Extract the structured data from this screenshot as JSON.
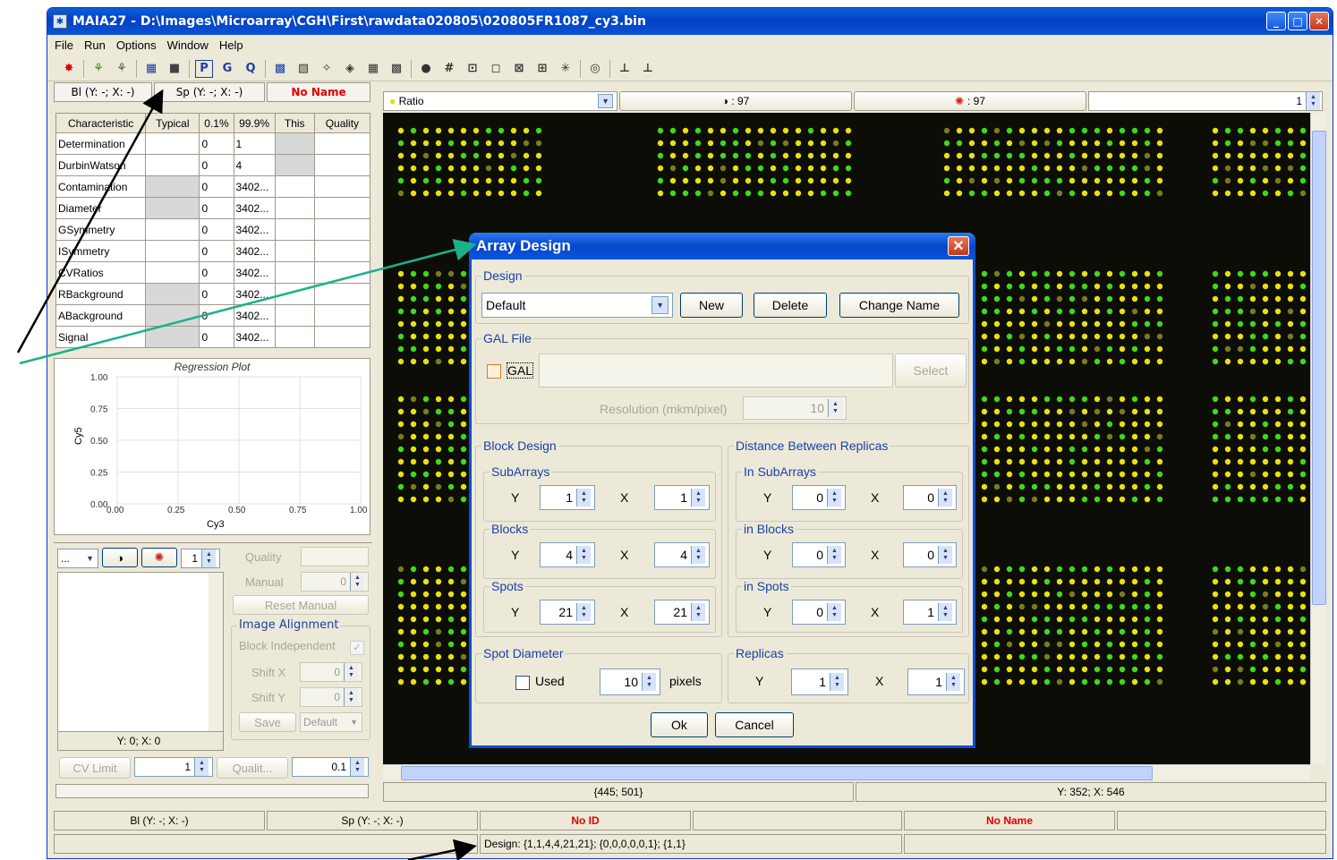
{
  "window": {
    "title": "MAIA27 - D:\\Images\\Microarray\\CGH\\First\\rawdata020805\\020805FR1087_cy3.bin",
    "menu": [
      "File",
      "Run",
      "Options",
      "Window",
      "Help"
    ]
  },
  "left_header": {
    "bl": "Bl (Y: -; X: -)",
    "sp": "Sp (Y: -; X: -)",
    "name": "No Name"
  },
  "char_table": {
    "headers": [
      "Characteristic",
      "Typical",
      "0.1%",
      "99.9%",
      "This",
      "Quality"
    ],
    "rows": [
      [
        "Determination",
        "",
        "0",
        "1",
        "",
        ""
      ],
      [
        "DurbinWatson",
        "",
        "0",
        "4",
        "",
        ""
      ],
      [
        "Contamination",
        "",
        "0",
        "3402...",
        "",
        ""
      ],
      [
        "Diameter",
        "",
        "0",
        "3402...",
        "",
        ""
      ],
      [
        "GSymmetry",
        "",
        "0",
        "3402...",
        "",
        ""
      ],
      [
        "ISymmetry",
        "",
        "0",
        "3402...",
        "",
        ""
      ],
      [
        "CVRatios",
        "",
        "0",
        "3402...",
        "",
        ""
      ],
      [
        "RBackground",
        "",
        "0",
        "3402...",
        "",
        ""
      ],
      [
        "ABackground",
        "",
        "0",
        "3402...",
        "",
        ""
      ],
      [
        "Signal",
        "",
        "0",
        "3402...",
        "",
        ""
      ]
    ]
  },
  "regression_plot": {
    "title": "Regression Plot",
    "xlabel": "Cy3",
    "ylabel": "Cy5",
    "ticks": [
      "0.00",
      "0.25",
      "0.50",
      "0.75",
      "1.00"
    ]
  },
  "controls": {
    "dropdown": "...",
    "spin_value": "1",
    "quality_label": "Quality",
    "manual_label": "Manual",
    "manual_value": "0",
    "reset_manual": "Reset Manual",
    "image_alignment": "Image Alignment",
    "block_independent": "Block Independent",
    "shift_x": "Shift X",
    "shift_x_value": "0",
    "shift_y": "Shift Y",
    "shift_y_value": "0",
    "save": "Save",
    "default": "Default",
    "coords": "Y: 0; X: 0",
    "cv_limit": "CV Limit",
    "cv_value": "1",
    "qualit": "Qualit...",
    "qualit_value": "0.1"
  },
  "image_bar": {
    "mode": "Ratio",
    "val1": "◑ : 97",
    "val2": ": 97",
    "spin": "1"
  },
  "image_status": {
    "left": "{445; 501}",
    "right": "Y: 352; X: 546"
  },
  "bottom_status": {
    "bl": "Bl (Y: -; X: -)",
    "sp": "Sp (Y: -; X: -)",
    "id": "No ID",
    "name": "No Name",
    "design": "Design: {1,1,4,4,21,21}; {0,0,0,0,0,1}; {1,1}"
  },
  "dialog": {
    "title": "Array Design",
    "design_group": "Design",
    "design_value": "Default",
    "new": "New",
    "delete": "Delete",
    "change_name": "Change Name",
    "gal_group": "GAL File",
    "gal_label": "GAL",
    "select": "Select",
    "resolution_label": "Resolution (mkm/pixel)",
    "resolution_value": "10",
    "block_design": "Block Design",
    "distance": "Distance Between Replicas",
    "subarrays": "SubArrays",
    "in_subarrays": "In SubArrays",
    "blocks": "Blocks",
    "in_blocks": "in Blocks",
    "spots": "Spots",
    "in_spots": "in Spots",
    "y": "Y",
    "x": "X",
    "sub_y": "1",
    "sub_x": "1",
    "blk_y": "4",
    "blk_x": "4",
    "spt_y": "21",
    "spt_x": "21",
    "in_sub_y": "0",
    "in_sub_x": "0",
    "in_blk_y": "0",
    "in_blk_x": "0",
    "in_spt_y": "0",
    "in_spt_x": "1",
    "spot_diameter": "Spot Diameter",
    "used": "Used",
    "diam_value": "10",
    "pixels": "pixels",
    "replicas": "Replicas",
    "rep_y": "1",
    "rep_x": "1",
    "ok": "Ok",
    "cancel": "Cancel"
  },
  "colors": {
    "spot_green": "#3fd81f",
    "spot_yellow": "#e8e010",
    "xp_blue": "#0b4fd6",
    "annotation_teal": "#1ab08c"
  }
}
